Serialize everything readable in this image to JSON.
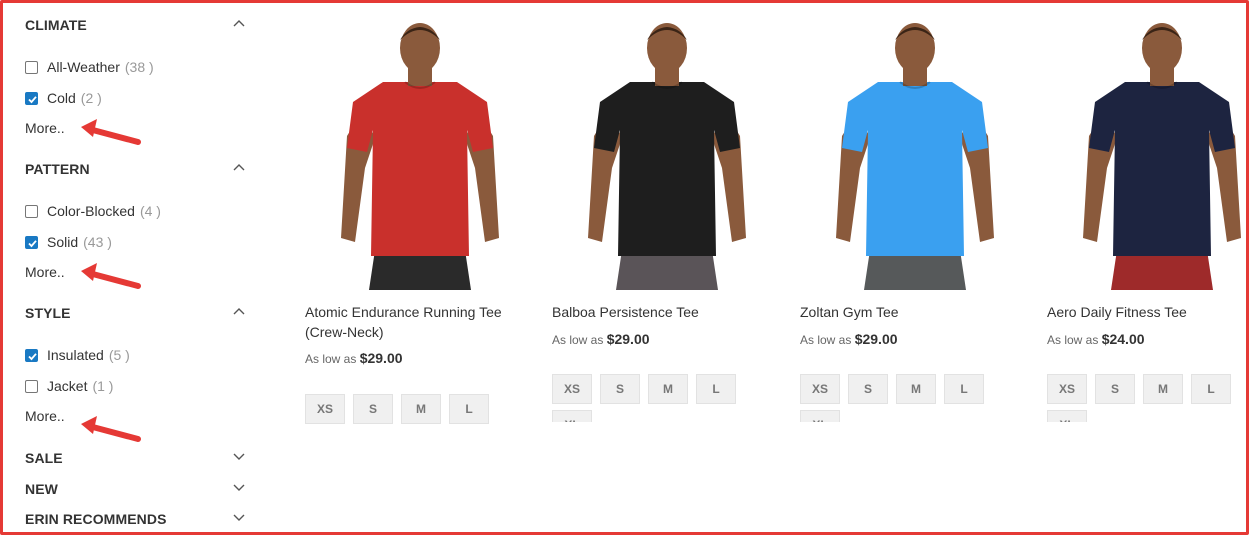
{
  "filters": {
    "climate": {
      "title": "CLIMATE",
      "options": [
        {
          "label": "All-Weather",
          "count": "(38 )",
          "checked": false
        },
        {
          "label": "Cold",
          "count": "(2 )",
          "checked": true
        }
      ],
      "more": "More.."
    },
    "pattern": {
      "title": "PATTERN",
      "options": [
        {
          "label": "Color-Blocked",
          "count": "(4 )",
          "checked": false
        },
        {
          "label": "Solid",
          "count": "(43 )",
          "checked": true
        }
      ],
      "more": "More.."
    },
    "style": {
      "title": "STYLE",
      "options": [
        {
          "label": "Insulated",
          "count": "(5 )",
          "checked": true
        },
        {
          "label": "Jacket",
          "count": "(1 )",
          "checked": false
        }
      ],
      "more": "More.."
    },
    "collapsed": [
      {
        "title": "SALE"
      },
      {
        "title": "NEW"
      },
      {
        "title": "ERIN RECOMMENDS"
      }
    ]
  },
  "products": [
    {
      "name": "Atomic Endurance Running Tee (Crew-Neck)",
      "price_prefix": "As low as",
      "price": "$29.00",
      "shirt_color": "#c9302c",
      "shorts_color": "#2a2a2a",
      "sizes": [
        "XS",
        "S",
        "M",
        "L"
      ]
    },
    {
      "name": "Balboa Persistence Tee",
      "price_prefix": "As low as",
      "price": "$29.00",
      "shirt_color": "#1e1e1e",
      "shorts_color": "#5a5458",
      "sizes": [
        "XS",
        "S",
        "M",
        "L",
        "XL"
      ]
    },
    {
      "name": "Zoltan Gym Tee",
      "price_prefix": "As low as",
      "price": "$29.00",
      "shirt_color": "#3aa0f0",
      "shorts_color": "#56595a",
      "sizes": [
        "XS",
        "S",
        "M",
        "L",
        "XL"
      ]
    },
    {
      "name": "Aero Daily Fitness Tee",
      "price_prefix": "As low as",
      "price": "$24.00",
      "shirt_color": "#1d2440",
      "shorts_color": "#9e2a2a",
      "sizes": [
        "XS",
        "S",
        "M",
        "L",
        "XL"
      ]
    }
  ],
  "colors": {
    "annotation_red": "#e53935",
    "checkbox_blue": "#1979c3"
  }
}
